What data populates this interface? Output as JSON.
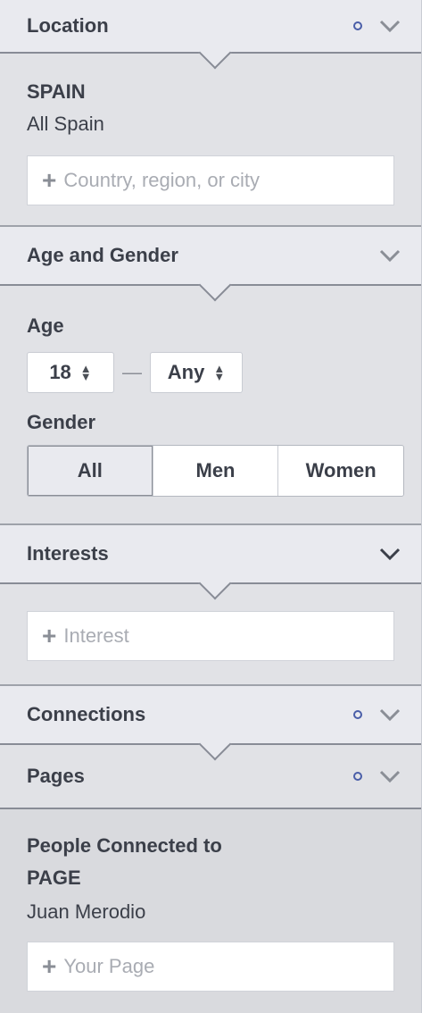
{
  "location": {
    "title": "Location",
    "country": "SPAIN",
    "scope": "All Spain",
    "placeholder": "Country, region, or city"
  },
  "age_gender": {
    "title": "Age and Gender",
    "age_label": "Age",
    "age_min": "18",
    "age_sep": "—",
    "age_max": "Any",
    "gender_label": "Gender",
    "genders": [
      "All",
      "Men",
      "Women"
    ]
  },
  "interests": {
    "title": "Interests",
    "placeholder": "Interest"
  },
  "connections": {
    "title": "Connections"
  },
  "pages": {
    "title": "Pages",
    "people_label_1": "People Connected to",
    "people_label_2": "PAGE",
    "page_value": "Juan Merodio",
    "placeholder": "Your Page"
  },
  "colors": {
    "accent_dot": "#4a5ea8",
    "header_bg": "#e9eaef",
    "body_bg": "#e1e2e6"
  }
}
